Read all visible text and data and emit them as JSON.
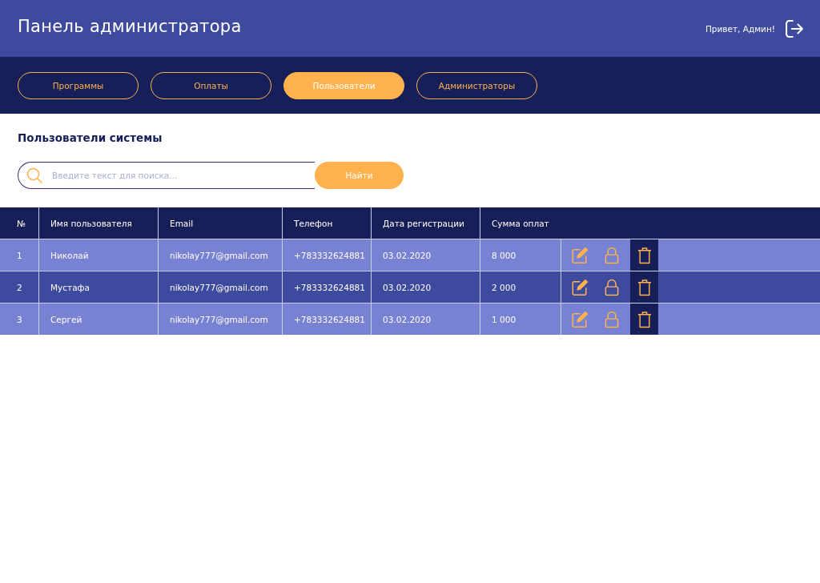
{
  "header": {
    "title": "Панель администратора",
    "greeting": "Привет, Админ!"
  },
  "tabs": [
    {
      "label": "Программы",
      "selected": false
    },
    {
      "label": "Оплаты",
      "selected": false
    },
    {
      "label": "Пользователи",
      "selected": true
    },
    {
      "label": "Администраторы",
      "selected": false
    }
  ],
  "section_title": "Пользователи системы",
  "search": {
    "placeholder": "Введите текст для поиска...",
    "button": "Найти"
  },
  "table": {
    "columns": [
      "№",
      "Имя пользователя",
      "Email",
      "Телефон",
      "Дата регистрации",
      "Сумма оплат"
    ],
    "rows": [
      {
        "cells": [
          "1",
          "Николай",
          "nikolay777@gmail.com",
          "+783332624881",
          "03.02.2020",
          "8 000"
        ]
      },
      {
        "cells": [
          "2",
          "Мустафа",
          "nikolay777@gmail.com",
          "+783332624881",
          "03.02.2020",
          "2 000"
        ]
      },
      {
        "cells": [
          "3",
          "Сергей",
          "nikolay777@gmail.com",
          "+783332624881",
          "03.02.2020",
          "1 000"
        ]
      }
    ]
  }
}
